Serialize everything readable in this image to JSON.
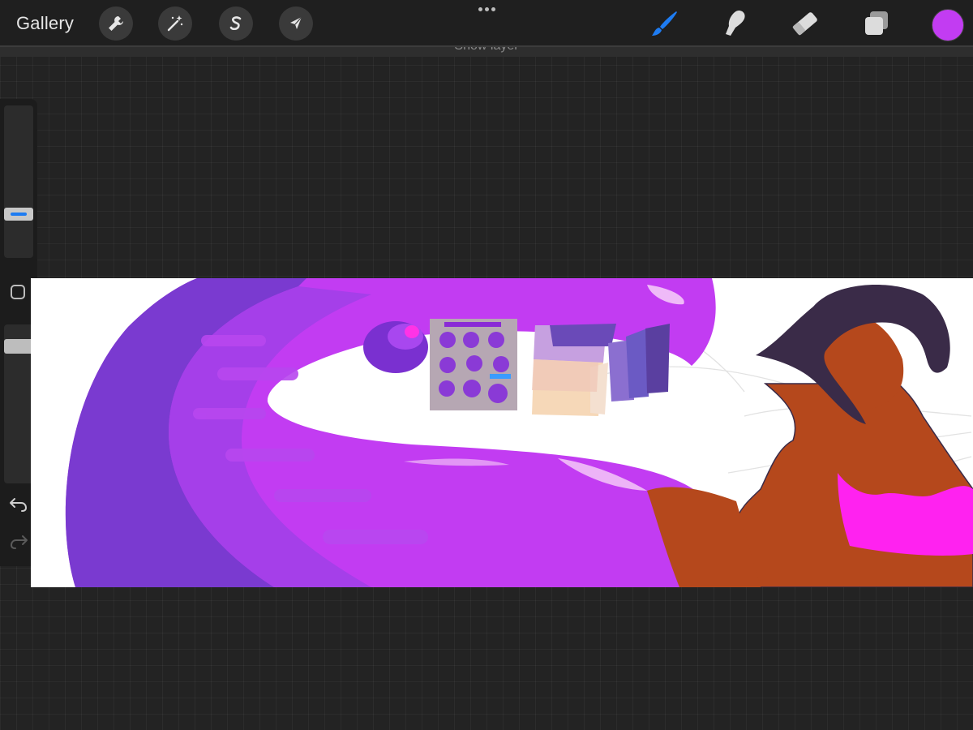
{
  "topbar": {
    "gallery_label": "Gallery",
    "left_tools": [
      {
        "name": "actions",
        "icon": "wrench-icon"
      },
      {
        "name": "adjustments",
        "icon": "magic-wand-icon"
      },
      {
        "name": "selection",
        "icon": "selection-s-icon"
      },
      {
        "name": "transform",
        "icon": "arrow-cursor-icon"
      }
    ],
    "right_tools": [
      {
        "name": "brush",
        "icon": "brush-icon",
        "active": true
      },
      {
        "name": "smudge",
        "icon": "smudge-finger-icon",
        "active": false
      },
      {
        "name": "eraser",
        "icon": "eraser-icon",
        "active": false
      },
      {
        "name": "layers",
        "icon": "layers-icon",
        "active": false
      }
    ],
    "current_color": "#c23cf2",
    "active_color": "#1e7cf2"
  },
  "toast": {
    "text": "Show layer"
  },
  "sidebar": {
    "brush_size_level": 0.27,
    "opacity_level": 0.1,
    "modify_icon": "square-modify-icon",
    "undo_icon": "undo-icon",
    "redo_icon": "redo-icon"
  },
  "canvas": {
    "background": "#ffffff",
    "colors": {
      "purple_dark": "#7a3ad0",
      "purple_mid": "#a040e8",
      "magenta": "#c83cf5",
      "skin": "#b5481c",
      "hair": "#3a2b48",
      "top": "#ff22f0"
    }
  }
}
